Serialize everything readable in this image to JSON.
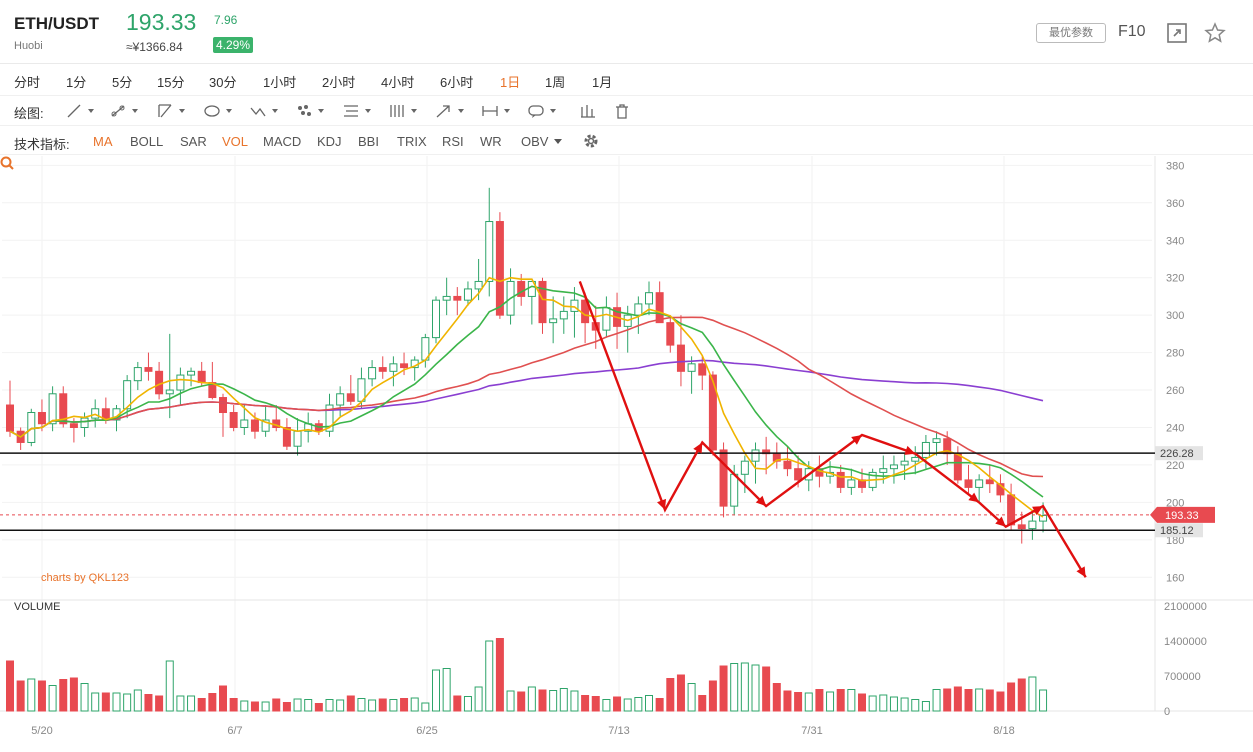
{
  "header": {
    "pair": "ETH/USDT",
    "exchange": "Huobi",
    "price": "193.33",
    "change": "7.96",
    "cny": "≈¥1366.84",
    "change_pct": "4.29%",
    "params_label": "最优参数",
    "f10_label": "F10"
  },
  "timeframes": [
    {
      "label": "分时",
      "active": false
    },
    {
      "label": "1分",
      "active": false
    },
    {
      "label": "5分",
      "active": false
    },
    {
      "label": "15分",
      "active": false
    },
    {
      "label": "30分",
      "active": false
    },
    {
      "label": "1小时",
      "active": false
    },
    {
      "label": "2小时",
      "active": false
    },
    {
      "label": "4小时",
      "active": false
    },
    {
      "label": "6小时",
      "active": false
    },
    {
      "label": "1日",
      "active": true
    },
    {
      "label": "1周",
      "active": false
    },
    {
      "label": "1月",
      "active": false
    }
  ],
  "drawing": {
    "label": "绘图:",
    "tools": [
      "line-tool-icon",
      "segment-tool-icon",
      "channel-tool-icon",
      "shape-tool-icon",
      "wave-tool-icon",
      "fib-tool-icon",
      "gann-tool-icon",
      "bars-tool-icon",
      "arrow-tool-icon",
      "range-tool-icon",
      "comment-tool-icon",
      "measure-tool-icon",
      "trash-icon"
    ]
  },
  "indicators": {
    "label": "技术指标:",
    "items": [
      {
        "label": "MA",
        "active": true
      },
      {
        "label": "BOLL",
        "active": false
      },
      {
        "label": "SAR",
        "active": false
      },
      {
        "label": "VOL",
        "active": true
      },
      {
        "label": "MACD",
        "active": false
      },
      {
        "label": "KDJ",
        "active": false
      },
      {
        "label": "BBI",
        "active": false
      },
      {
        "label": "TRIX",
        "active": false
      },
      {
        "label": "RSI",
        "active": false
      },
      {
        "label": "WR",
        "active": false
      },
      {
        "label": "OBV",
        "active": false
      }
    ]
  },
  "chart": {
    "watermark": "charts by QKL123",
    "volume_title": "VOLUME",
    "price_ticks": [
      "380",
      "360",
      "340",
      "320",
      "300",
      "280",
      "260",
      "240",
      "220",
      "200",
      "180",
      "160"
    ],
    "volume_ticks": [
      "2100000",
      "1400000",
      "700000",
      "0"
    ],
    "date_ticks": [
      "5/20",
      "6/7",
      "6/25",
      "7/13",
      "7/31",
      "8/18"
    ],
    "line_labels": [
      "226.28",
      "193.33",
      "185.12"
    ],
    "colors": {
      "up": "#2ea46a",
      "down": "#e84a50",
      "ma5": "#f0b400",
      "ma10": "#3bb54a",
      "ma20": "#e05050",
      "ma60": "#8a3fd1",
      "annot": "#e01010"
    }
  },
  "chart_data": {
    "type": "candlestick",
    "x_start": "5/17",
    "x_end": "8/18",
    "ylim": [
      150,
      385
    ],
    "volume_ylim": [
      0,
      2100000
    ],
    "candles": [
      [
        252,
        265,
        235,
        238,
        1000000
      ],
      [
        238,
        240,
        228,
        232,
        600000
      ],
      [
        232,
        250,
        230,
        248,
        640000
      ],
      [
        248,
        255,
        238,
        242,
        600000
      ],
      [
        242,
        262,
        238,
        258,
        510000
      ],
      [
        258,
        262,
        240,
        242,
        630000
      ],
      [
        242,
        245,
        232,
        240,
        660000
      ],
      [
        240,
        248,
        235,
        245,
        550000
      ],
      [
        245,
        255,
        240,
        250,
        360000
      ],
      [
        250,
        256,
        242,
        244,
        360000
      ],
      [
        244,
        252,
        238,
        250,
        360000
      ],
      [
        250,
        268,
        245,
        265,
        340000
      ],
      [
        265,
        275,
        260,
        272,
        420000
      ],
      [
        272,
        280,
        265,
        270,
        330000
      ],
      [
        270,
        275,
        255,
        258,
        300000
      ],
      [
        258,
        290,
        245,
        260,
        1000000
      ],
      [
        260,
        272,
        252,
        268,
        300000
      ],
      [
        268,
        272,
        262,
        270,
        300000
      ],
      [
        270,
        275,
        262,
        264,
        250000
      ],
      [
        264,
        275,
        255,
        256,
        350000
      ],
      [
        256,
        258,
        235,
        248,
        500000
      ],
      [
        248,
        252,
        238,
        240,
        250000
      ],
      [
        240,
        252,
        236,
        244,
        200000
      ],
      [
        244,
        248,
        234,
        238,
        180000
      ],
      [
        238,
        252,
        235,
        244,
        180000
      ],
      [
        244,
        252,
        238,
        240,
        240000
      ],
      [
        240,
        245,
        228,
        230,
        170000
      ],
      [
        230,
        245,
        225,
        238,
        240000
      ],
      [
        238,
        248,
        232,
        242,
        230000
      ],
      [
        242,
        244,
        236,
        238,
        150000
      ],
      [
        238,
        258,
        235,
        252,
        230000
      ],
      [
        252,
        262,
        246,
        258,
        220000
      ],
      [
        258,
        268,
        252,
        254,
        300000
      ],
      [
        254,
        272,
        250,
        266,
        250000
      ],
      [
        266,
        276,
        262,
        272,
        220000
      ],
      [
        272,
        278,
        266,
        270,
        240000
      ],
      [
        270,
        278,
        262,
        274,
        230000
      ],
      [
        274,
        280,
        268,
        272,
        250000
      ],
      [
        272,
        278,
        265,
        276,
        260000
      ],
      [
        276,
        290,
        272,
        288,
        160000
      ],
      [
        288,
        310,
        285,
        308,
        820000
      ],
      [
        308,
        320,
        300,
        310,
        850000
      ],
      [
        310,
        315,
        300,
        308,
        300000
      ],
      [
        308,
        318,
        305,
        314,
        290000
      ],
      [
        314,
        330,
        308,
        318,
        480000
      ],
      [
        318,
        368,
        310,
        350,
        1400000
      ],
      [
        350,
        355,
        298,
        300,
        1450000
      ],
      [
        300,
        325,
        295,
        318,
        400000
      ],
      [
        318,
        322,
        305,
        310,
        380000
      ],
      [
        310,
        318,
        295,
        318,
        480000
      ],
      [
        318,
        320,
        290,
        296,
        420000
      ],
      [
        296,
        310,
        285,
        298,
        410000
      ],
      [
        298,
        310,
        290,
        302,
        450000
      ],
      [
        302,
        315,
        288,
        308,
        400000
      ],
      [
        308,
        312,
        285,
        296,
        310000
      ],
      [
        296,
        305,
        282,
        292,
        290000
      ],
      [
        292,
        310,
        288,
        304,
        230000
      ],
      [
        304,
        312,
        282,
        294,
        280000
      ],
      [
        294,
        305,
        280,
        300,
        240000
      ],
      [
        300,
        310,
        290,
        306,
        270000
      ],
      [
        306,
        318,
        300,
        312,
        310000
      ],
      [
        312,
        318,
        298,
        296,
        250000
      ],
      [
        296,
        300,
        280,
        284,
        650000
      ],
      [
        284,
        300,
        262,
        270,
        720000
      ],
      [
        270,
        278,
        258,
        274,
        550000
      ],
      [
        274,
        278,
        260,
        268,
        310000
      ],
      [
        268,
        270,
        225,
        228,
        600000
      ],
      [
        228,
        232,
        192,
        198,
        900000
      ],
      [
        198,
        220,
        193,
        215,
        950000
      ],
      [
        215,
        225,
        205,
        222,
        960000
      ],
      [
        222,
        232,
        210,
        228,
        920000
      ],
      [
        228,
        235,
        215,
        226,
        880000
      ],
      [
        226,
        232,
        218,
        222,
        550000
      ],
      [
        222,
        230,
        214,
        218,
        400000
      ],
      [
        218,
        225,
        208,
        212,
        370000
      ],
      [
        212,
        222,
        206,
        218,
        360000
      ],
      [
        218,
        225,
        208,
        214,
        430000
      ],
      [
        214,
        222,
        210,
        216,
        380000
      ],
      [
        216,
        220,
        205,
        208,
        430000
      ],
      [
        208,
        218,
        204,
        212,
        430000
      ],
      [
        212,
        218,
        205,
        208,
        340000
      ],
      [
        208,
        218,
        206,
        216,
        300000
      ],
      [
        216,
        225,
        210,
        218,
        320000
      ],
      [
        218,
        225,
        210,
        220,
        280000
      ],
      [
        220,
        226,
        212,
        222,
        260000
      ],
      [
        222,
        230,
        215,
        224,
        230000
      ],
      [
        224,
        236,
        218,
        232,
        190000
      ],
      [
        232,
        238,
        225,
        234,
        430000
      ],
      [
        234,
        238,
        220,
        226,
        440000
      ],
      [
        226,
        230,
        210,
        212,
        480000
      ],
      [
        212,
        220,
        205,
        208,
        430000
      ],
      [
        208,
        215,
        200,
        212,
        440000
      ],
      [
        212,
        220,
        205,
        210,
        420000
      ],
      [
        210,
        215,
        200,
        204,
        380000
      ],
      [
        204,
        210,
        185,
        188,
        560000
      ],
      [
        188,
        195,
        178,
        186,
        640000
      ],
      [
        186,
        195,
        180,
        190,
        680000
      ],
      [
        190,
        200,
        184,
        193,
        420000
      ]
    ],
    "hlines": [
      226.28,
      185.12
    ],
    "last_price": 193.33
  }
}
